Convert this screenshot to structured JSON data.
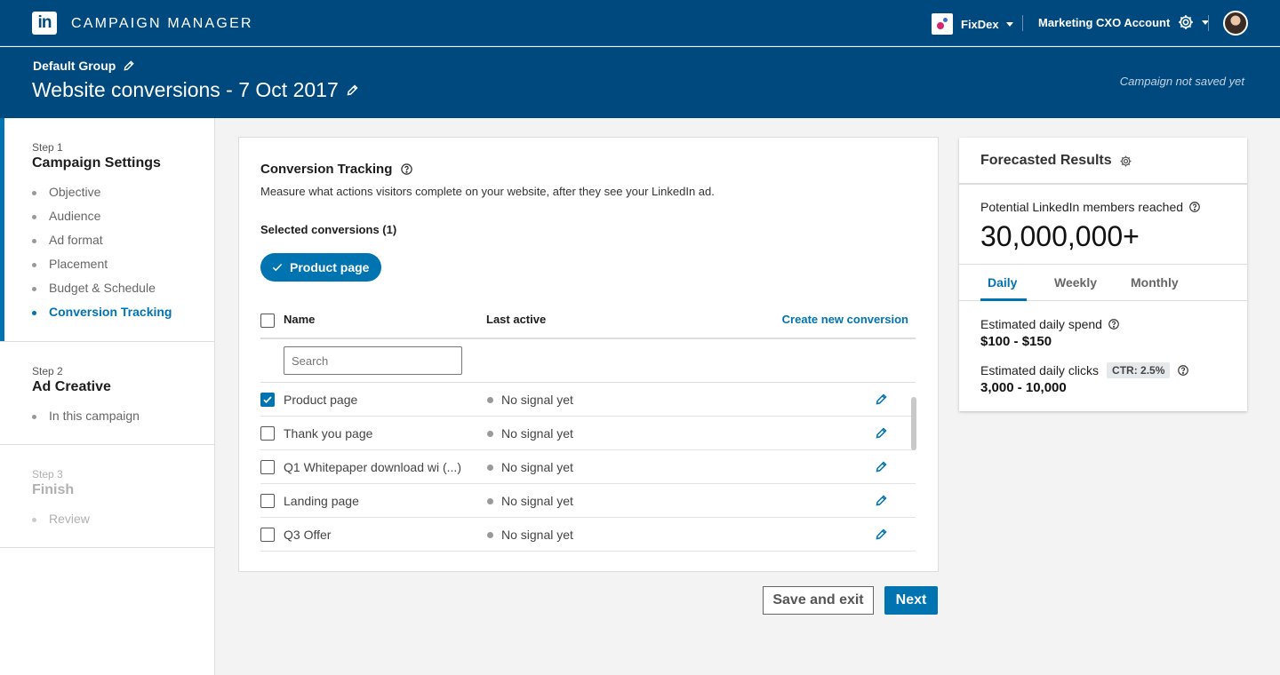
{
  "app": {
    "logo_text": "in",
    "title": "CAMPAIGN MANAGER"
  },
  "topnav": {
    "company": "FixDex",
    "account": "Marketing CXO Account"
  },
  "header": {
    "group": "Default Group",
    "campaign_title": "Website conversions - 7 Oct 2017",
    "save_status": "Campaign not saved yet"
  },
  "sidebar": {
    "steps": [
      {
        "num": "Step 1",
        "name": "Campaign Settings",
        "items": [
          "Objective",
          "Audience",
          "Ad format",
          "Placement",
          "Budget & Schedule",
          "Conversion Tracking"
        ]
      },
      {
        "num": "Step 2",
        "name": "Ad Creative",
        "items": [
          "In this campaign"
        ]
      },
      {
        "num": "Step 3",
        "name": "Finish",
        "items": [
          "Review"
        ]
      }
    ]
  },
  "main": {
    "title": "Conversion Tracking",
    "description": "Measure what actions visitors complete on your website, after they see your LinkedIn ad.",
    "selected_label": "Selected conversions (1)",
    "chip_label": "Product page",
    "columns": {
      "name": "Name",
      "last_active": "Last active"
    },
    "create_link": "Create new conversion",
    "search_placeholder": "Search",
    "rows": [
      {
        "name": "Product page",
        "status": "No signal yet",
        "checked": true
      },
      {
        "name": "Thank you page",
        "status": "No signal yet",
        "checked": false
      },
      {
        "name": "Q1 Whitepaper download wi (...)",
        "status": "No signal yet",
        "checked": false
      },
      {
        "name": "Landing page",
        "status": "No signal yet",
        "checked": false
      },
      {
        "name": "Q3 Offer",
        "status": "No signal yet",
        "checked": false
      }
    ],
    "save_exit_label": "Save and exit",
    "next_label": "Next"
  },
  "forecast": {
    "title": "Forecasted Results",
    "reach_label": "Potential LinkedIn members reached",
    "reach_value": "30,000,000+",
    "tabs": [
      "Daily",
      "Weekly",
      "Monthly"
    ],
    "spend_label": "Estimated daily spend",
    "spend_value": "$100 - $150",
    "clicks_label": "Estimated daily clicks",
    "ctr_badge": "CTR: 2.5%",
    "clicks_value": "3,000 - 10,000"
  },
  "colors": {
    "brand": "#00497e",
    "accent": "#0073b1"
  }
}
